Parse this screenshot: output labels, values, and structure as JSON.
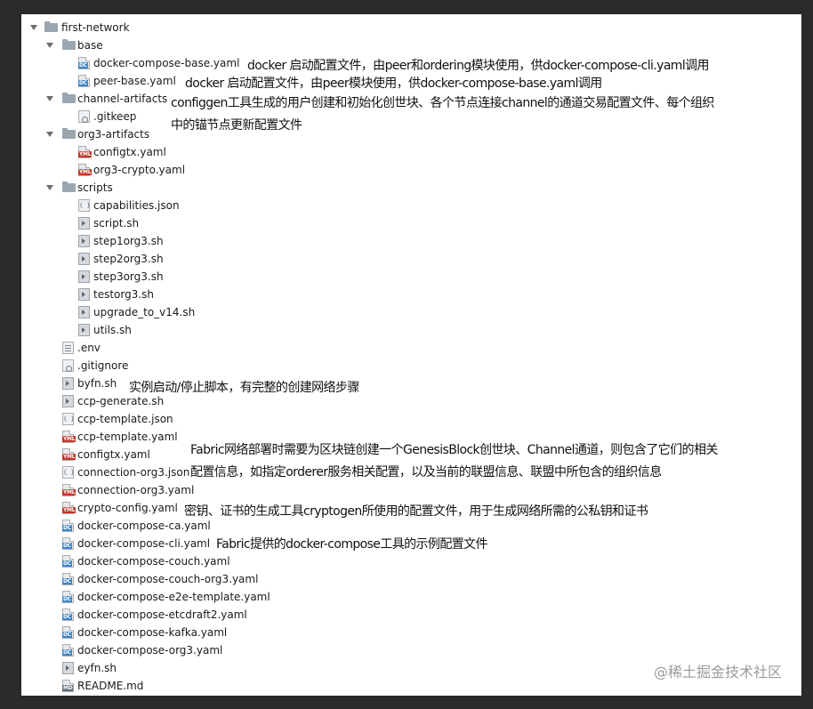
{
  "tree": [
    {
      "label": "first-network",
      "kind": "folder",
      "depth": 0,
      "expanded": true
    },
    {
      "label": "base",
      "kind": "folder",
      "depth": 1,
      "expanded": true
    },
    {
      "label": "docker-compose-base.yaml",
      "kind": "dc",
      "depth": 2
    },
    {
      "label": "peer-base.yaml",
      "kind": "dc",
      "depth": 2
    },
    {
      "label": "channel-artifacts",
      "kind": "folder",
      "depth": 1,
      "expanded": true
    },
    {
      "label": ".gitkeep",
      "kind": "ignore",
      "depth": 2
    },
    {
      "label": "org3-artifacts",
      "kind": "folder",
      "depth": 1,
      "expanded": true
    },
    {
      "label": "configtx.yaml",
      "kind": "yml",
      "depth": 2
    },
    {
      "label": "org3-crypto.yaml",
      "kind": "yml",
      "depth": 2
    },
    {
      "label": "scripts",
      "kind": "folder",
      "depth": 1,
      "expanded": true
    },
    {
      "label": "capabilities.json",
      "kind": "json",
      "depth": 2
    },
    {
      "label": "script.sh",
      "kind": "sh",
      "depth": 2
    },
    {
      "label": "step1org3.sh",
      "kind": "sh",
      "depth": 2
    },
    {
      "label": "step2org3.sh",
      "kind": "sh",
      "depth": 2
    },
    {
      "label": "step3org3.sh",
      "kind": "sh",
      "depth": 2
    },
    {
      "label": "testorg3.sh",
      "kind": "sh",
      "depth": 2
    },
    {
      "label": "upgrade_to_v14.sh",
      "kind": "sh",
      "depth": 2
    },
    {
      "label": "utils.sh",
      "kind": "sh",
      "depth": 2
    },
    {
      "label": ".env",
      "kind": "env",
      "depth": 1
    },
    {
      "label": ".gitignore",
      "kind": "ignore",
      "depth": 1
    },
    {
      "label": "byfn.sh",
      "kind": "sh",
      "depth": 1
    },
    {
      "label": "ccp-generate.sh",
      "kind": "sh",
      "depth": 1
    },
    {
      "label": "ccp-template.json",
      "kind": "json",
      "depth": 1
    },
    {
      "label": "ccp-template.yaml",
      "kind": "yml",
      "depth": 1
    },
    {
      "label": "configtx.yaml",
      "kind": "yml",
      "depth": 1
    },
    {
      "label": "connection-org3.json",
      "kind": "json",
      "depth": 1
    },
    {
      "label": "connection-org3.yaml",
      "kind": "yml",
      "depth": 1
    },
    {
      "label": "crypto-config.yaml",
      "kind": "yml",
      "depth": 1
    },
    {
      "label": "docker-compose-ca.yaml",
      "kind": "dc",
      "depth": 1
    },
    {
      "label": "docker-compose-cli.yaml",
      "kind": "dc",
      "depth": 1
    },
    {
      "label": "docker-compose-couch.yaml",
      "kind": "dc",
      "depth": 1
    },
    {
      "label": "docker-compose-couch-org3.yaml",
      "kind": "dc",
      "depth": 1
    },
    {
      "label": "docker-compose-e2e-template.yaml",
      "kind": "dc",
      "depth": 1
    },
    {
      "label": "docker-compose-etcdraft2.yaml",
      "kind": "dc",
      "depth": 1
    },
    {
      "label": "docker-compose-kafka.yaml",
      "kind": "dc",
      "depth": 1
    },
    {
      "label": "docker-compose-org3.yaml",
      "kind": "dc",
      "depth": 1
    },
    {
      "label": "eyfn.sh",
      "kind": "sh",
      "depth": 1
    },
    {
      "label": "README.md",
      "kind": "md",
      "depth": 1
    }
  ],
  "badges": {
    "dc": "DC",
    "yml": "YML",
    "md": "MD"
  },
  "annotations": {
    "docker_compose_base": "docker 启动配置文件，由peer和ordering模块使用，供docker-compose-cli.yaml调用",
    "peer_base": "docker 启动配置文件，由peer模块使用，供docker-compose-base.yaml调用",
    "channel_artifacts_1": "configgen工具生成的用户创建和初始化创世块、各个节点连接channel的通道交易配置文件、每个组织",
    "channel_artifacts_2": "中的锚节点更新配置文件",
    "byfn": "实例启动/停止脚本，有完整的创建网络步骤",
    "configtx_1": "Fabric网络部署时需要为区块链创建一个GenesisBlock创世块、Channel通道，则包含了它们的相关",
    "configtx_2": "配置信息，如指定orderer服务相关配置，以及当前的联盟信息、联盟中所包含的组织信息",
    "crypto_config": "密钥、证书的生成工具cryptogen所使用的配置文件，用于生成网络所需的公私钥和证书",
    "docker_compose_cli": "Fabric提供的docker-compose工具的示例配置文件"
  },
  "watermark": "@稀土掘金技术社区",
  "colors": {
    "background": "#2b2b2b",
    "panel": "#ffffff",
    "folder": "#9aa7b0",
    "dc_badge": "#3d84c6",
    "yml_badge": "#c0392b"
  }
}
